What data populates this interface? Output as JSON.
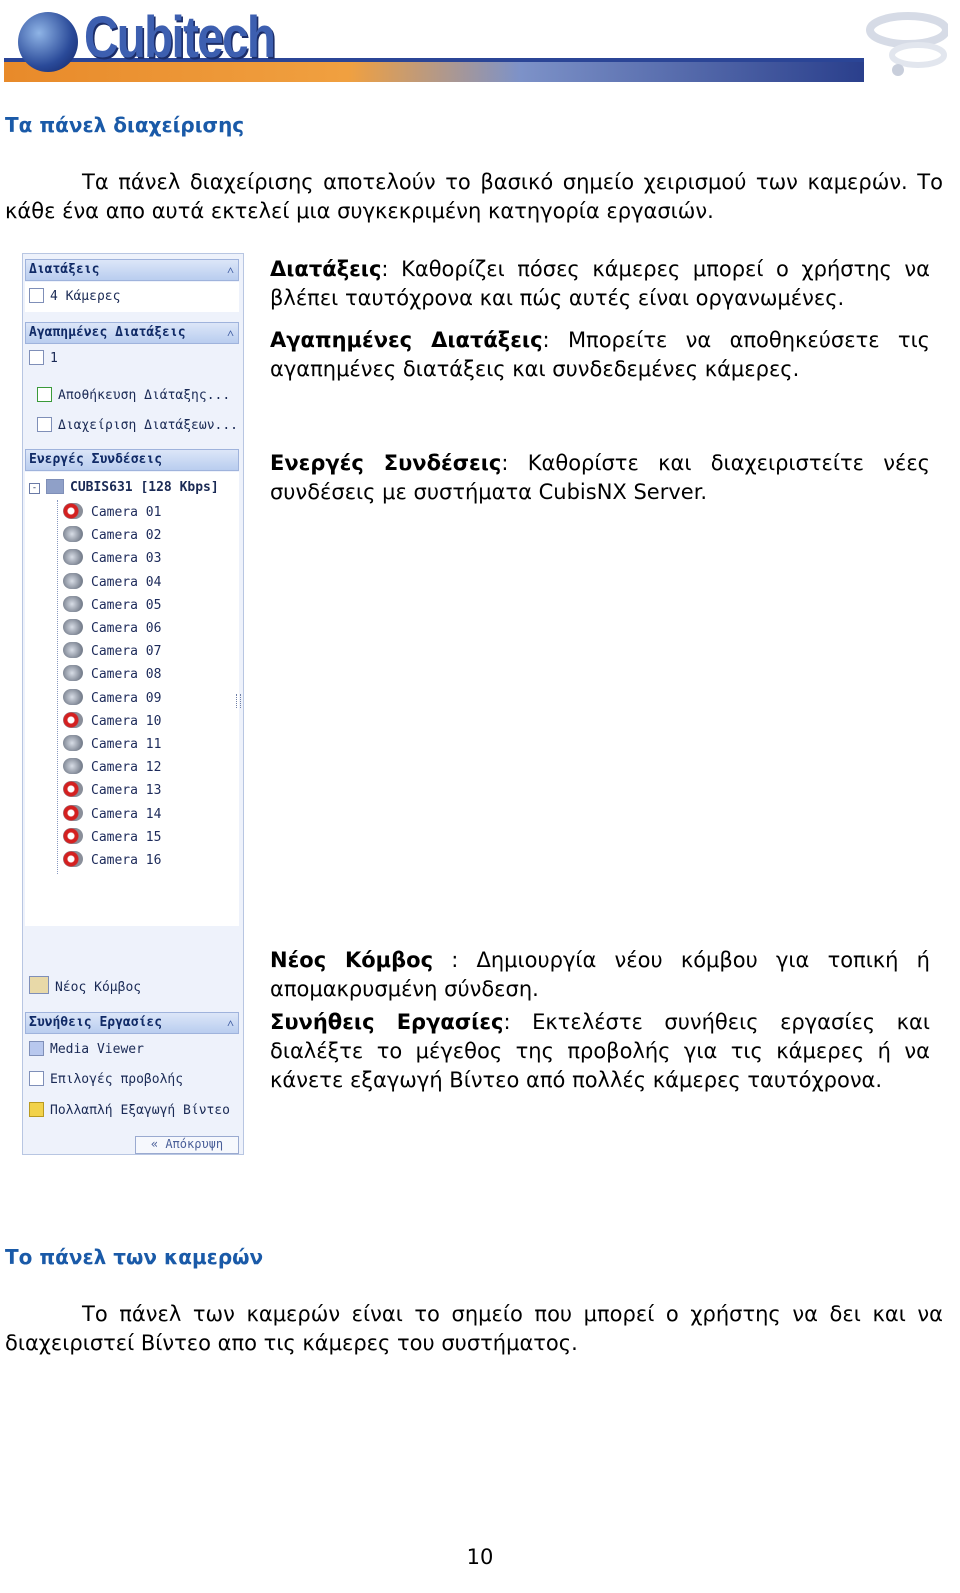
{
  "brand": {
    "logo_text": "Cubitech"
  },
  "section1": {
    "title": "Τα πάνελ διαχείρισης",
    "intro": "Τα πάνελ διαχείρισης αποτελούν το βασικό σημείο χειρισμού των καμερών. Το κάθε ένα απο αυτά εκτελεί μια συγκεκριμένη κατηγορία εργασιών."
  },
  "descriptions": [
    {
      "term": "Διατάξεις",
      "sep": ": ",
      "text": "Καθορίζει πόσες κάμερες μπορεί ο χρήστης να βλέπει ταυτόχρονα και πώς αυτές είναι οργανωμένες."
    },
    {
      "term": "Αγαπημένες Διατάξεις",
      "sep": ":  ",
      "text": "Μπορείτε να αποθηκεύσετε τις αγαπημένες διατάξεις και συνδεδεμένες κάμερες."
    },
    {
      "term": "Ενεργές Συνδέσεις",
      "sep": ": ",
      "text": "Καθορίστε και διαχειριστείτε νέες συνδέσεις με συστήματα CubisNX Server."
    },
    {
      "term": "Νέος Κόμβος",
      "sep": " : ",
      "text": "Δημιουργία νέου κόμβου για τοπική ή απομακρυσμένη σύνδεση."
    },
    {
      "term": "Συνήθεις Εργασίες",
      "sep": ": ",
      "text": "Εκτελέστε συνήθεις εργασίες και διαλέξτε το μέγεθος της προβολής  για τις κάμερες ή να κάνετε εξαγωγή Βίντεο από πολλές κάμερες ταυτόχρονα."
    }
  ],
  "panel": {
    "layouts_header": "Διατάξεις",
    "layouts_value": "4 Κάμερες",
    "fav_header": "Αγαπημένες Διατάξεις",
    "fav_value": "1",
    "save_layout": "Αποθήκευση Διάταξης...",
    "manage_layouts": "Διαχείριση Διατάξεων...",
    "connections_header": "Ενεργές Συνδέσεις",
    "server_node": "CUBIS631 [128 Kbps]",
    "cameras": [
      {
        "label": "Camera 01",
        "status": "error"
      },
      {
        "label": "Camera 02",
        "status": "ok"
      },
      {
        "label": "Camera 03",
        "status": "ok"
      },
      {
        "label": "Camera 04",
        "status": "ok"
      },
      {
        "label": "Camera 05",
        "status": "ok"
      },
      {
        "label": "Camera 06",
        "status": "ok"
      },
      {
        "label": "Camera 07",
        "status": "ok"
      },
      {
        "label": "Camera 08",
        "status": "ok"
      },
      {
        "label": "Camera 09",
        "status": "ok"
      },
      {
        "label": "Camera 10",
        "status": "error"
      },
      {
        "label": "Camera 11",
        "status": "ok"
      },
      {
        "label": "Camera 12",
        "status": "ok"
      },
      {
        "label": "Camera 13",
        "status": "error"
      },
      {
        "label": "Camera 14",
        "status": "error"
      },
      {
        "label": "Camera 15",
        "status": "error"
      },
      {
        "label": "Camera 16",
        "status": "error"
      }
    ],
    "new_node": "Νέος Κόμβος",
    "tasks_header": "Συνήθεις Εργασίες",
    "media_viewer": "Media Viewer",
    "view_options": "Επιλογές προβολής",
    "multi_export": "Πολλαπλή Εξαγωγή Βίντεο",
    "hide_button": "«  Απόκρυψη"
  },
  "section2": {
    "title": "Το πάνελ των καμερών",
    "intro": "Το πάνελ των καμερών είναι το σημείο που μπορεί ο χρήστης να δει και να διαχειριστεί Βίντεο απο τις κάμερες του συστήματος."
  },
  "page_number": "10"
}
